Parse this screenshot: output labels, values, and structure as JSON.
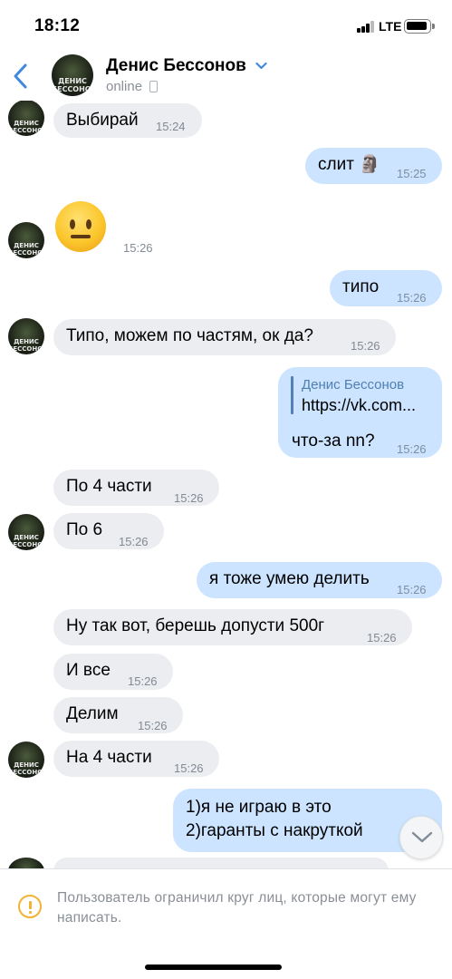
{
  "status_bar": {
    "time": "18:12",
    "network": "LTE",
    "battery_level": 0.85
  },
  "header": {
    "contact_name": "Денис Бессонов",
    "status": "online",
    "avatar_text": "ДЕНИС БЕССОНОВ",
    "icons": {
      "back": "back-chevron-icon",
      "dropdown": "chevron-down-icon",
      "device": "phone-icon"
    }
  },
  "messages": [
    {
      "dir": "in",
      "text": "Выбирай",
      "time": "15:24"
    },
    {
      "dir": "out",
      "text": "слит 🗿",
      "time": "15:25"
    },
    {
      "dir": "in",
      "emoji": "neutral-face-emoji",
      "time": "15:26"
    },
    {
      "dir": "out",
      "text": "типо",
      "time": "15:26"
    },
    {
      "dir": "in",
      "text": "Типо, можем по частям, ок да?",
      "time": "15:26"
    },
    {
      "dir": "out",
      "reply_author": "Денис Бессонов",
      "reply_text": "https://vk.com...",
      "text": "что-за nn?",
      "time": "15:26"
    },
    {
      "dir": "in",
      "text": "По 4 части",
      "time": "15:26"
    },
    {
      "dir": "in",
      "text": "По 6",
      "time": "15:26"
    },
    {
      "dir": "out",
      "text": "я тоже умею делить",
      "time": "15:26"
    },
    {
      "dir": "in",
      "text": "Ну так вот, берешь допусти 500г",
      "time": "15:26"
    },
    {
      "dir": "in",
      "text": "И все",
      "time": "15:26"
    },
    {
      "dir": "in",
      "text": "Делим",
      "time": "15:26"
    },
    {
      "dir": "in",
      "text": "На 4 части",
      "time": "15:26"
    },
    {
      "dir": "out",
      "text": "1)я не играю в это",
      "text2": "2)гаранты с накруткой"
    }
  ],
  "notice": {
    "text": "Пользователь ограничил круг лиц, которые могут ему написать.",
    "icon": "warning-icon"
  },
  "scroll_down_icon": "chevron-down-icon",
  "colors": {
    "incoming_bubble": "#ebedf0",
    "outgoing_bubble": "#cce4ff",
    "accent": "#4f7fb0",
    "warning": "#f2b233"
  }
}
